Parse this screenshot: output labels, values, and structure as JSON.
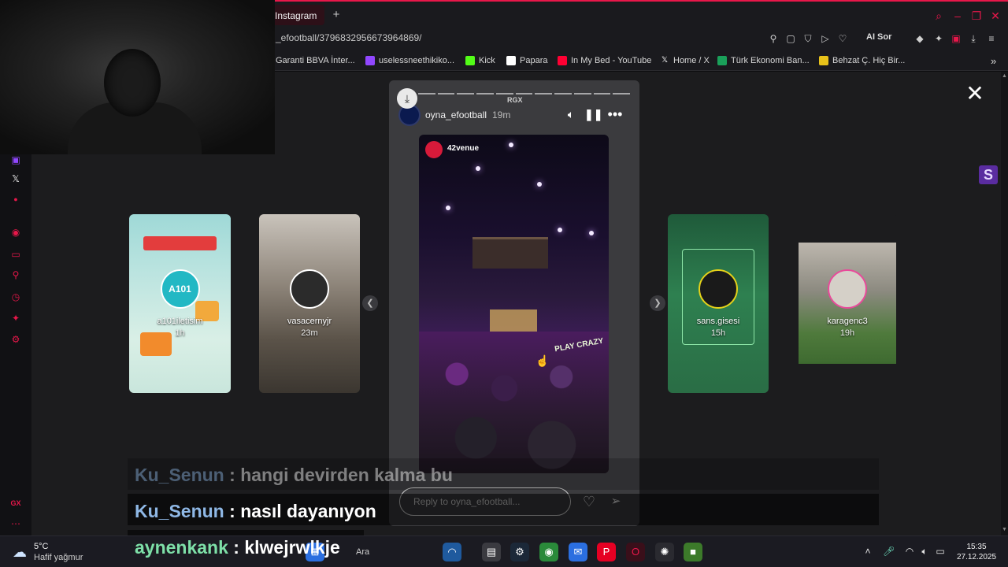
{
  "browser": {
    "tab_title": "Instagram",
    "new_tab": "+",
    "url": "_efootball/3796832956673964869/",
    "ai_label": "AI Sor",
    "bookmarks": [
      {
        "label": "Garanti BBVA İnter...",
        "icon": "garanti-icon",
        "color": "#1a1a1e"
      },
      {
        "label": "uselessneethikiko...",
        "icon": "twitch-icon",
        "color": "#9147ff"
      },
      {
        "label": "Kick",
        "icon": "kick-icon",
        "color": "#53fc18"
      },
      {
        "label": "Papara",
        "icon": "papara-icon",
        "color": "#ffffff"
      },
      {
        "label": "In My Bed - YouTube",
        "icon": "youtube-icon",
        "color": "#ff0033"
      },
      {
        "label": "Home / X",
        "icon": "x-icon",
        "color": "#1a1a1e"
      },
      {
        "label": "Türk Ekonomi Ban...",
        "icon": "teb-icon",
        "color": "#1aa05a"
      },
      {
        "label": "Behzat Ç. Hiç Bir...",
        "icon": "behzat-icon",
        "color": "#e8c21a"
      }
    ]
  },
  "story": {
    "username": "oyna_efootball",
    "time": "19m",
    "rgx": "RGX",
    "venue_name": "42venue",
    "play_sign": "PLAY CRAZY",
    "reply_placeholder": "Reply to oyna_efootball...",
    "progress_segments": 12
  },
  "side_stories": [
    {
      "name": "a101iletisim",
      "time": "1h",
      "avatar_text": "A101"
    },
    {
      "name": "vasacernyjr",
      "time": "23m",
      "avatar_text": ""
    },
    {
      "name": "sans.gisesi",
      "time": "15h",
      "avatar_text": ""
    },
    {
      "name": "karagenc3",
      "time": "19h",
      "avatar_text": ""
    }
  ],
  "chat": [
    {
      "user": "Ku_Senun",
      "sep": " : ",
      "msg": "hangi devirden kalma bu",
      "user_color": "#8fb8e6"
    },
    {
      "user": "Ku_Senun",
      "sep": " : ",
      "msg": "nasıl dayanıyon",
      "user_color": "#8fb8e6"
    },
    {
      "user": "aynenkank",
      "sep": " : ",
      "msg": "klwejrwlkje",
      "user_color": "#7ee0a8"
    }
  ],
  "taskbar": {
    "temperature": "5°C",
    "condition": "Hafif yağmur",
    "search_label": "Ara",
    "time": "15:35",
    "date": "27.12.2025"
  },
  "sidebar_badge": "S",
  "colors": {
    "accent": "#e8174a",
    "story_panel": "#3b3b3e"
  }
}
